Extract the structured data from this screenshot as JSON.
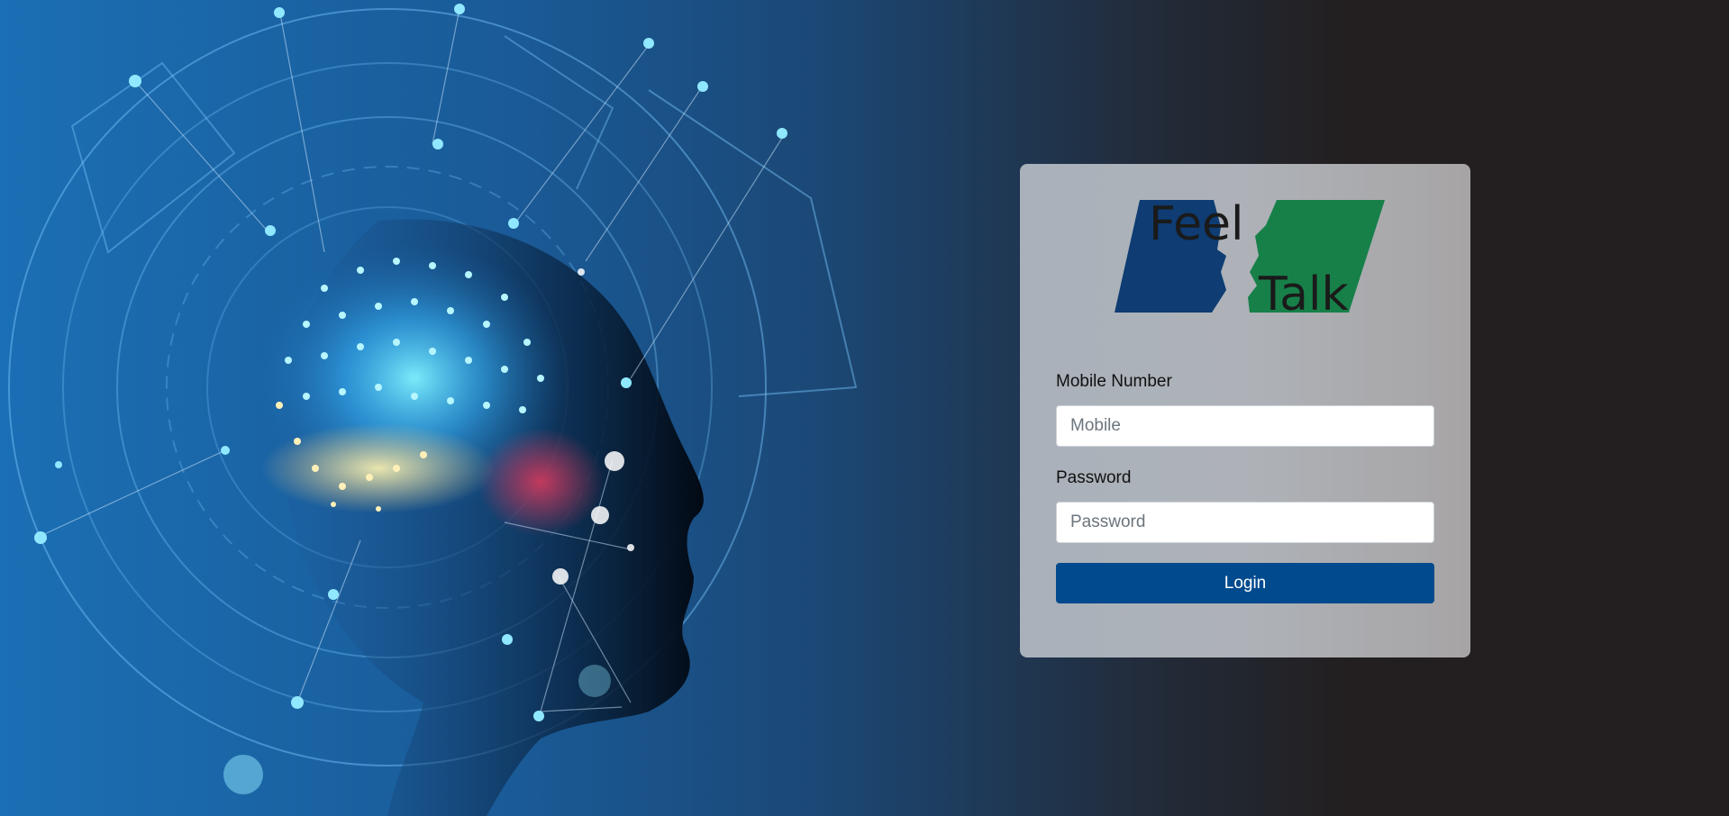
{
  "logo": {
    "word_top": "Feel",
    "word_bottom": "Talk"
  },
  "form": {
    "mobile_label": "Mobile Number",
    "mobile_placeholder": "Mobile",
    "mobile_value": "",
    "password_label": "Password",
    "password_placeholder": "Password",
    "password_value": "",
    "login_label": "Login"
  },
  "colors": {
    "login_button": "#004a8d",
    "logo_blue": "#0e3c73",
    "logo_green": "#178049"
  }
}
